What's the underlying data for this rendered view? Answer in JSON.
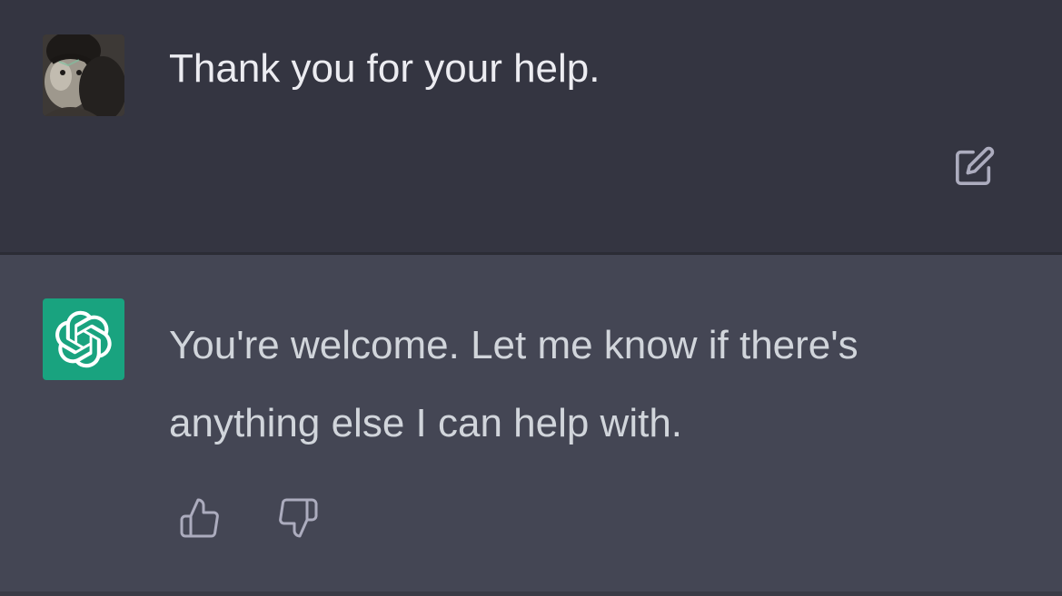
{
  "conversation": {
    "user_message": {
      "avatar_icon": "user-photo-avatar",
      "text": "Thank you for your help.",
      "edit_icon": "edit-icon"
    },
    "assistant_message": {
      "avatar_icon": "openai-logo-icon",
      "text": "You're welcome. Let me know if there's anything else I can help with.",
      "like_icon": "thumbs-up-icon",
      "dislike_icon": "thumbs-down-icon"
    }
  },
  "colors": {
    "user_bg": "#343541",
    "assistant_bg": "#444654",
    "bot_avatar_bg": "#19a37f",
    "user_text": "#ececf1",
    "assistant_text": "#d1d5db",
    "icon": "#acacbe"
  }
}
